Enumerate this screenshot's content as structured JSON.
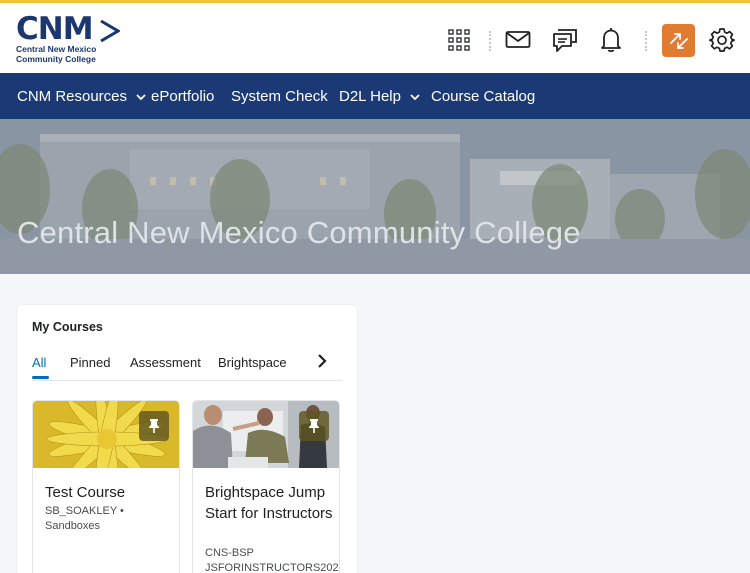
{
  "header": {
    "logo": {
      "wordmark": "CNM",
      "line1": "Central New Mexico",
      "line2": "Community College"
    },
    "icons": [
      "apps-grid-icon",
      "mail-icon",
      "chat-icon",
      "bell-icon",
      "role-switch-icon",
      "gear-icon"
    ],
    "accent_top": "#f1c232",
    "accent_button": "#e07b31"
  },
  "nav": {
    "background": "#1b3a75",
    "items": [
      {
        "label": "CNM Resources",
        "has_dropdown": true
      },
      {
        "label": "ePortfolio",
        "has_dropdown": false
      },
      {
        "label": "System Check",
        "has_dropdown": false
      },
      {
        "label": "D2L Help",
        "has_dropdown": true
      },
      {
        "label": "Course Catalog",
        "has_dropdown": false
      }
    ]
  },
  "banner": {
    "title": "Central New Mexico Community College"
  },
  "my_courses": {
    "title": "My Courses",
    "tabs": [
      {
        "label": "All",
        "active": true
      },
      {
        "label": "Pinned",
        "active": false
      },
      {
        "label": "Assessment",
        "active": false
      },
      {
        "label": "Brightspace",
        "active": false
      }
    ],
    "courses": [
      {
        "name": "Test Course",
        "meta1": "SB_SOAKLEY  •",
        "meta2": "Sandboxes",
        "pinned": true
      },
      {
        "name": "Brightspace Jump Start for Instructors",
        "meta1": "CNS-BSP",
        "meta2": "JSFORINSTRUCTORS202",
        "pinned": true
      }
    ]
  }
}
